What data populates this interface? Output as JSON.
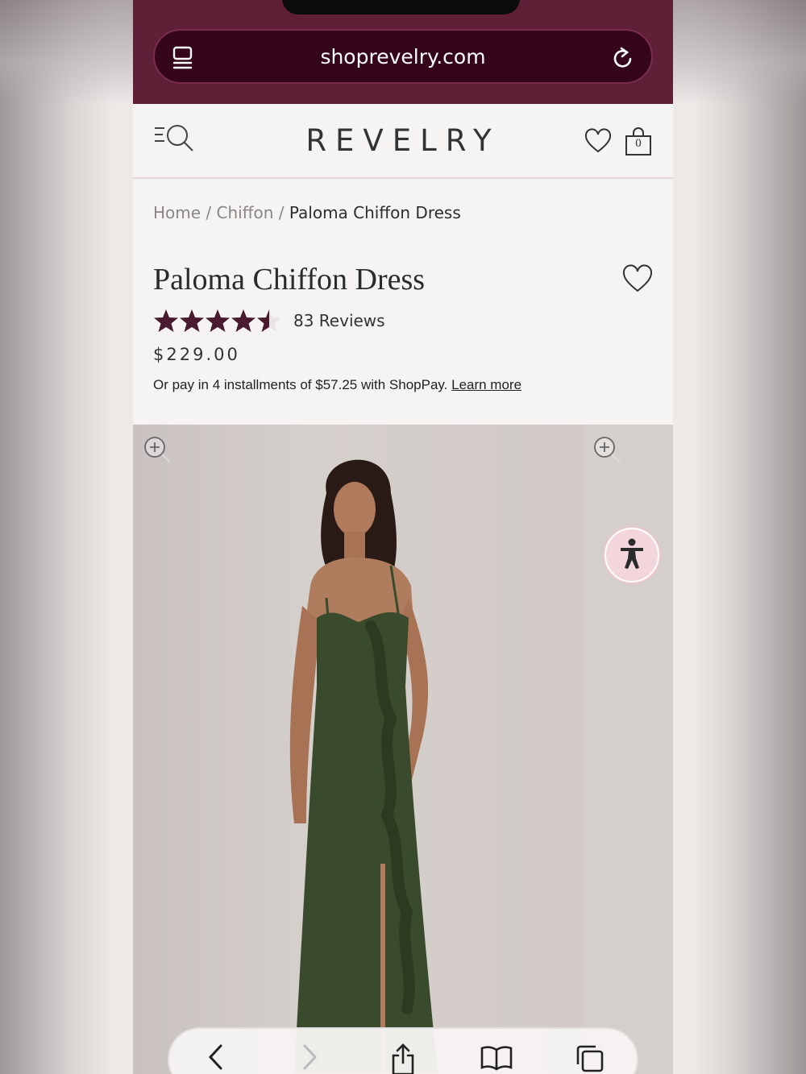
{
  "browser": {
    "url": "shoprevelry.com",
    "tabs_icon": "tabs-overview-icon",
    "reload_icon": "reload-icon"
  },
  "header": {
    "logo": "REVELRY",
    "cart_count": "0",
    "icons": [
      "menu-search-icon",
      "heart-icon",
      "shopping-bag-icon"
    ]
  },
  "breadcrumb": {
    "home": "Home",
    "sep1": " / ",
    "category": "Chiffon",
    "sep2": " / ",
    "current": "Paloma Chiffon Dress"
  },
  "product": {
    "title": "Paloma Chiffon Dress",
    "rating": 4.5,
    "rating_max": 5,
    "reviews": "83 Reviews",
    "price": "$229.00",
    "installments_text": "Or pay in 4 installments of $57.25 with ShopPay. ",
    "learn_more": "Learn more"
  },
  "colors": {
    "brand": "#5e1f37",
    "url_bar": "#35051c",
    "star": "#4a1a2e",
    "dress": "#3a4a2c"
  },
  "toolbar": {
    "icons": [
      "back-icon",
      "forward-icon",
      "share-icon",
      "bookmarks-icon",
      "tabs-icon"
    ]
  }
}
